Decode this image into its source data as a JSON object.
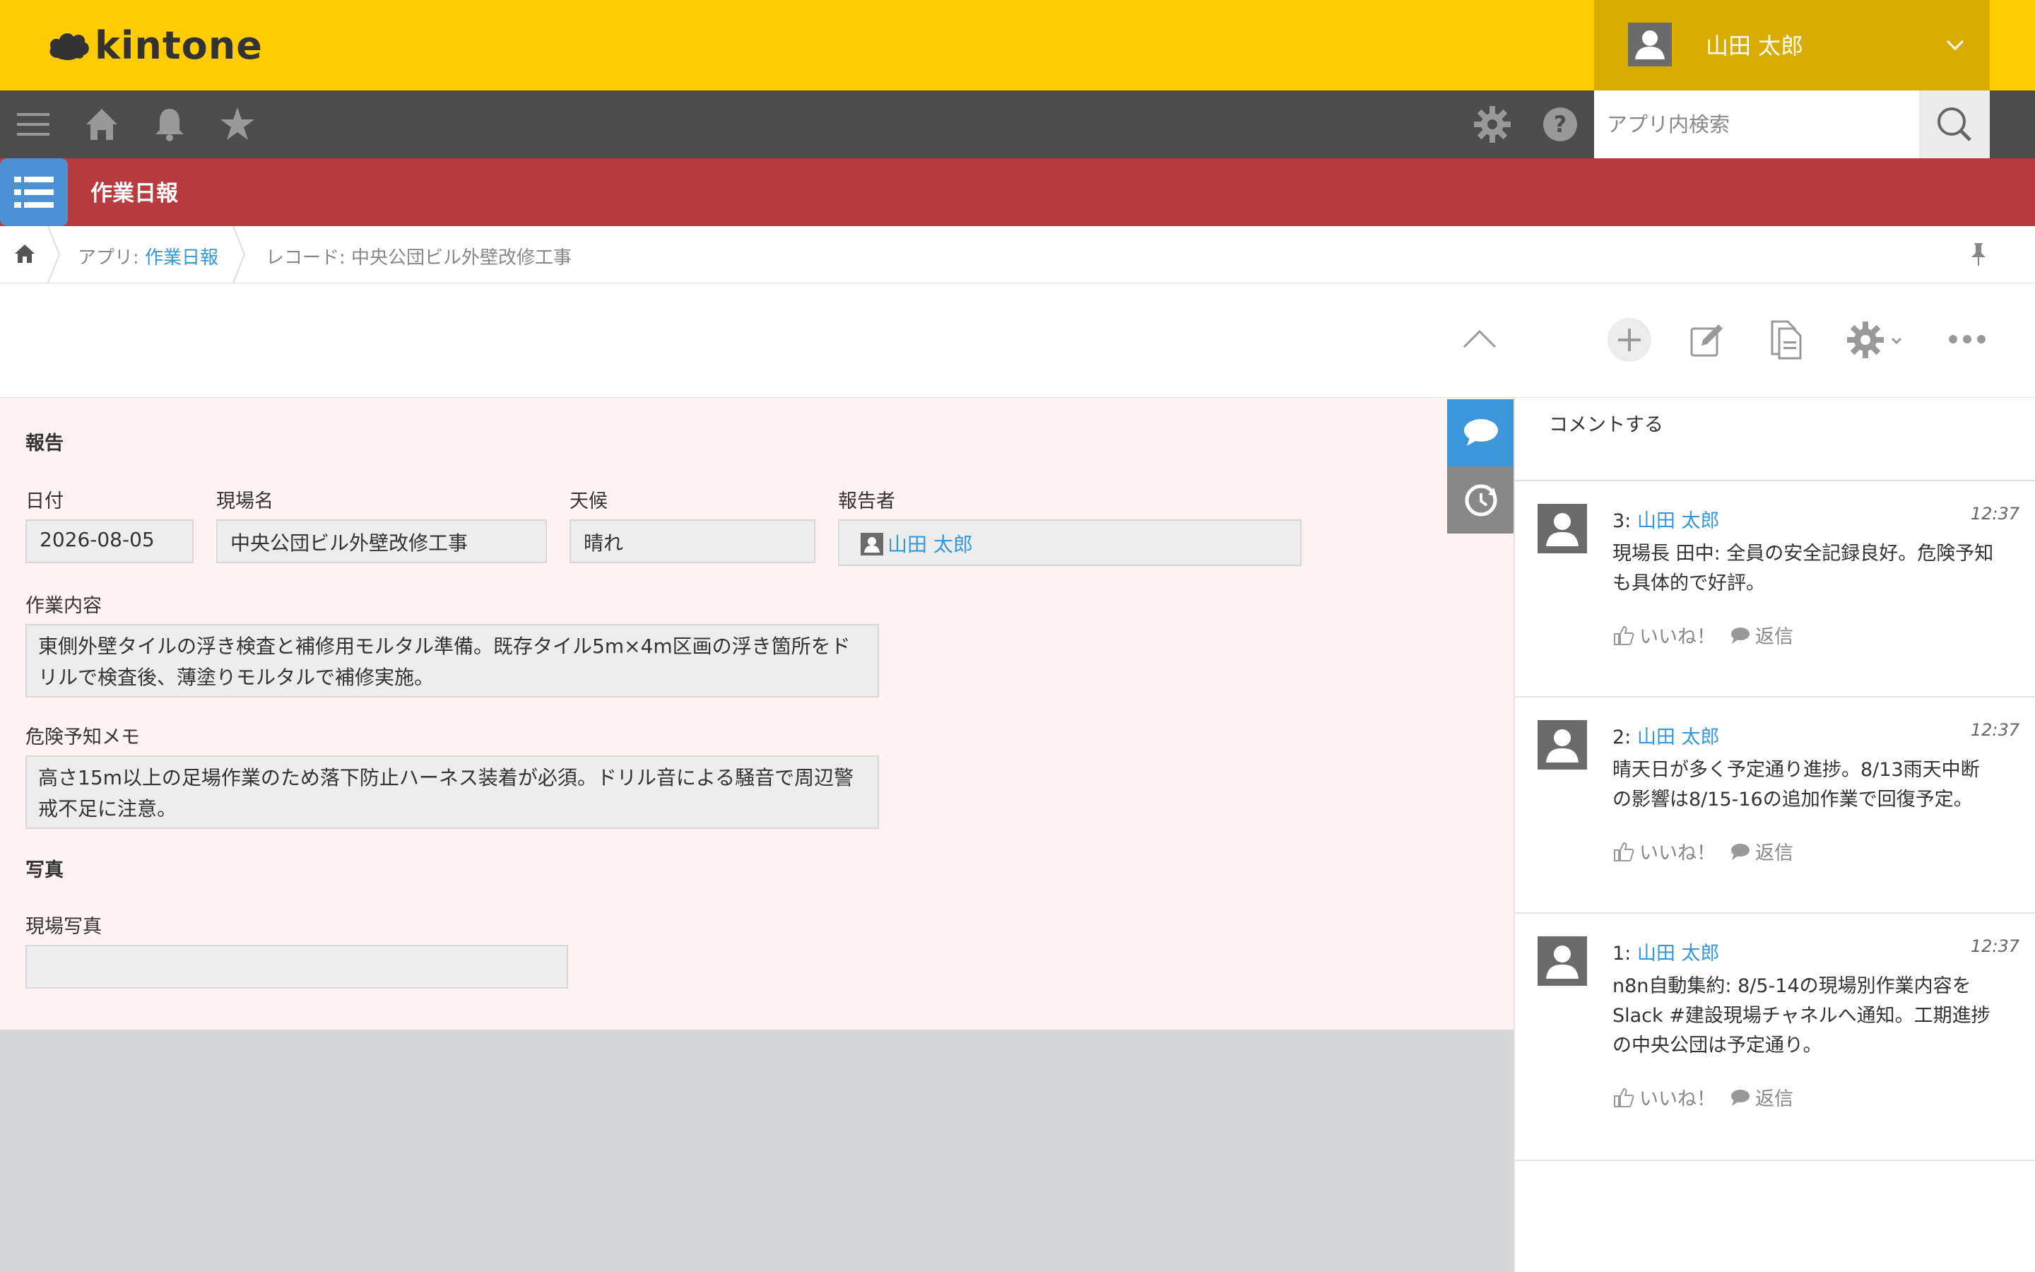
{
  "header": {
    "logo_text": "kintone",
    "user_name": "山田 太郎"
  },
  "nav": {
    "search_placeholder": "アプリ内検索"
  },
  "app": {
    "title": "作業日報"
  },
  "breadcrumb": {
    "app_prefix": "アプリ: ",
    "app_name": "作業日報",
    "record": "レコード: 中央公団ビル外壁改修工事"
  },
  "record": {
    "section_report": "報告",
    "date_label": "日付",
    "date_value": "2026-08-05",
    "site_label": "現場名",
    "site_value": "中央公団ビル外壁改修工事",
    "weather_label": "天候",
    "weather_value": "晴れ",
    "reporter_label": "報告者",
    "reporter_value": "山田 太郎",
    "work_label": "作業内容",
    "work_line1": "東側外壁タイルの浮き検査と補修用モルタル準備。既存タイル5m×4m区画の浮き箇所をド",
    "work_line2": "リルで検査後、薄塗りモルタルで補修実施。",
    "risk_label": "危険予知メモ",
    "risk_line1": "高さ15m以上の足場作業のため落下防止ハーネス装着が必須。ドリル音による騒音で周辺警",
    "risk_line2": "戒不足に注意。",
    "section_photo": "写真",
    "photo_label": "現場写真"
  },
  "comments": {
    "prompt": "コメントする",
    "like_label": "いいね！",
    "reply_label": "返信",
    "items": [
      {
        "number": "3:",
        "author": "山田 太郎",
        "time": "12:37",
        "line1": "現場長 田中: 全員の安全記録良好。危険予知",
        "line2": "も具体的で好評。",
        "line3": ""
      },
      {
        "number": "2:",
        "author": "山田 太郎",
        "time": "12:37",
        "line1": "晴天日が多く予定通り進捗。8/13雨天中断",
        "line2": "の影響は8/15-16の追加作業で回復予定。",
        "line3": ""
      },
      {
        "number": "1:",
        "author": "山田 太郎",
        "time": "12:37",
        "line1": "n8n自動集約: 8/5-14の現場別作業内容を",
        "line2": "Slack #建設現場チャネルへ通知。工期進捗",
        "line3": "の中央公団は予定通り。"
      }
    ]
  },
  "colors": {
    "header_yellow": "#ffcc00",
    "nav_gray": "#4d4d4d",
    "app_red": "#b83c3e",
    "link_blue": "#3498db",
    "record_bg": "#fff4f3"
  }
}
